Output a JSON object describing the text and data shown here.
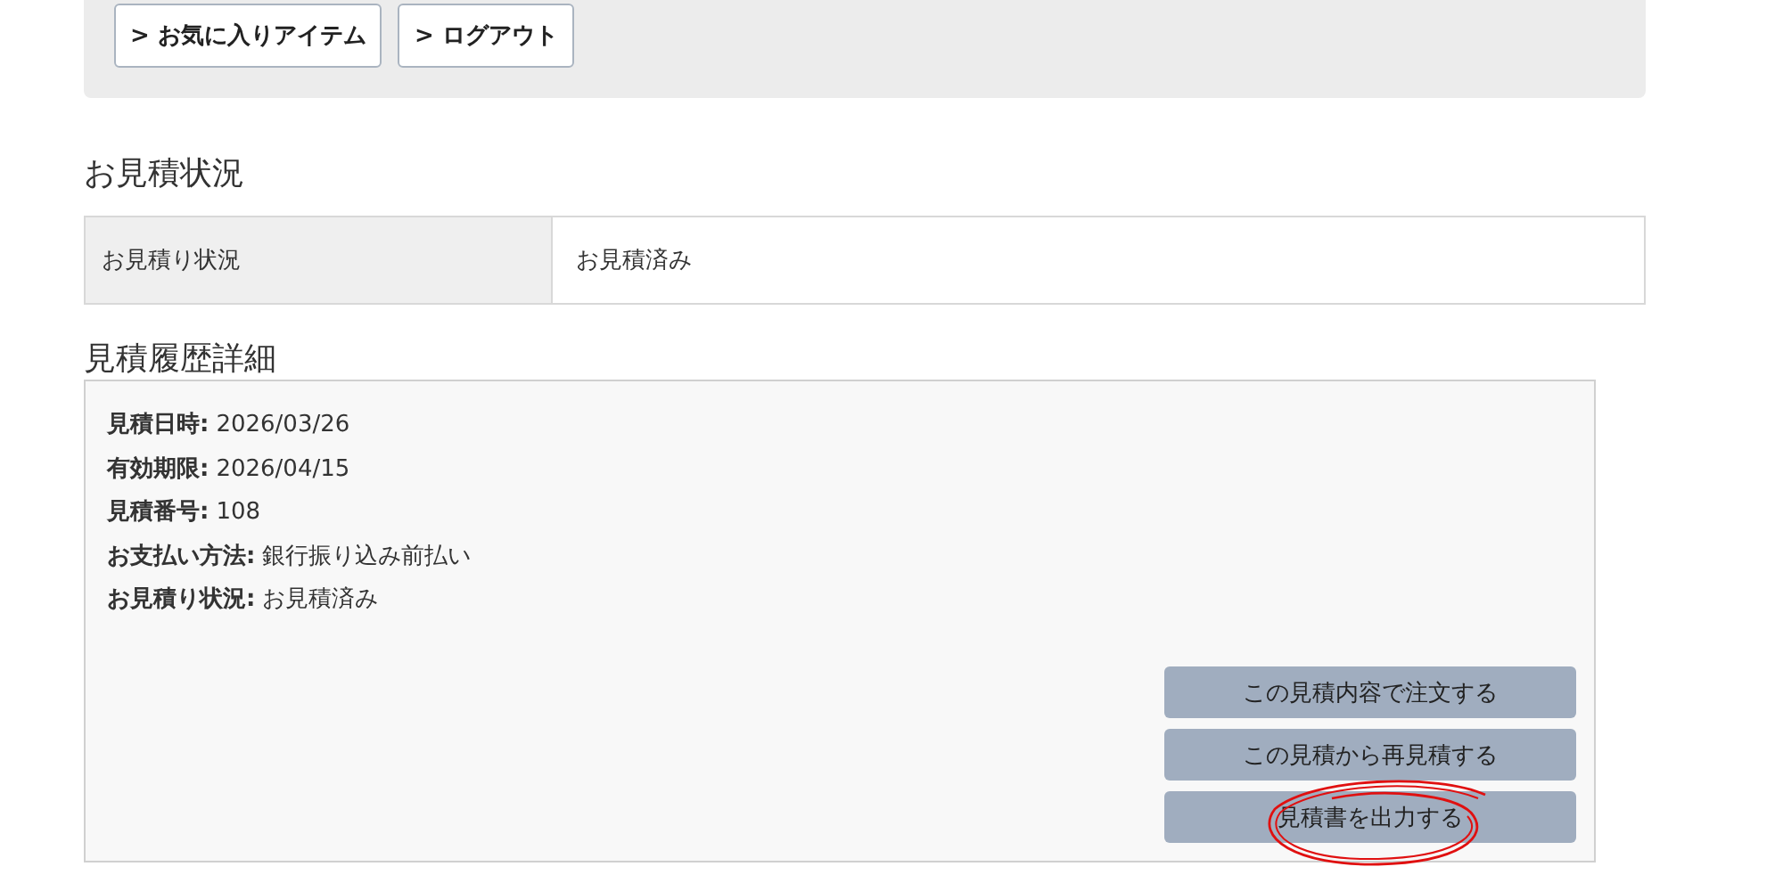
{
  "top_links": [
    {
      "icon": ">",
      "label": "お気に入りアイテム"
    },
    {
      "icon": ">",
      "label": "ログアウト"
    }
  ],
  "status_section": {
    "heading": "お見積状況",
    "rows": [
      {
        "label": "お見積り状況",
        "value": "お見積済み"
      }
    ]
  },
  "history_section": {
    "heading": "見積履歴詳細",
    "details": [
      {
        "label": "見積日時:",
        "value": "2026/03/26"
      },
      {
        "label": "有効期限:",
        "value": "2026/04/15"
      },
      {
        "label": "見積番号:",
        "value": "108"
      },
      {
        "label": "お支払い方法:",
        "value": "銀行振り込み前払い"
      },
      {
        "label": "お見積り状況:",
        "value": "お見積済み"
      }
    ],
    "buttons": [
      {
        "label": "この見積内容で注文する",
        "circled": false
      },
      {
        "label": "この見積から再見積する",
        "circled": false
      },
      {
        "label": "見積書を出力する",
        "circled": true
      }
    ]
  }
}
